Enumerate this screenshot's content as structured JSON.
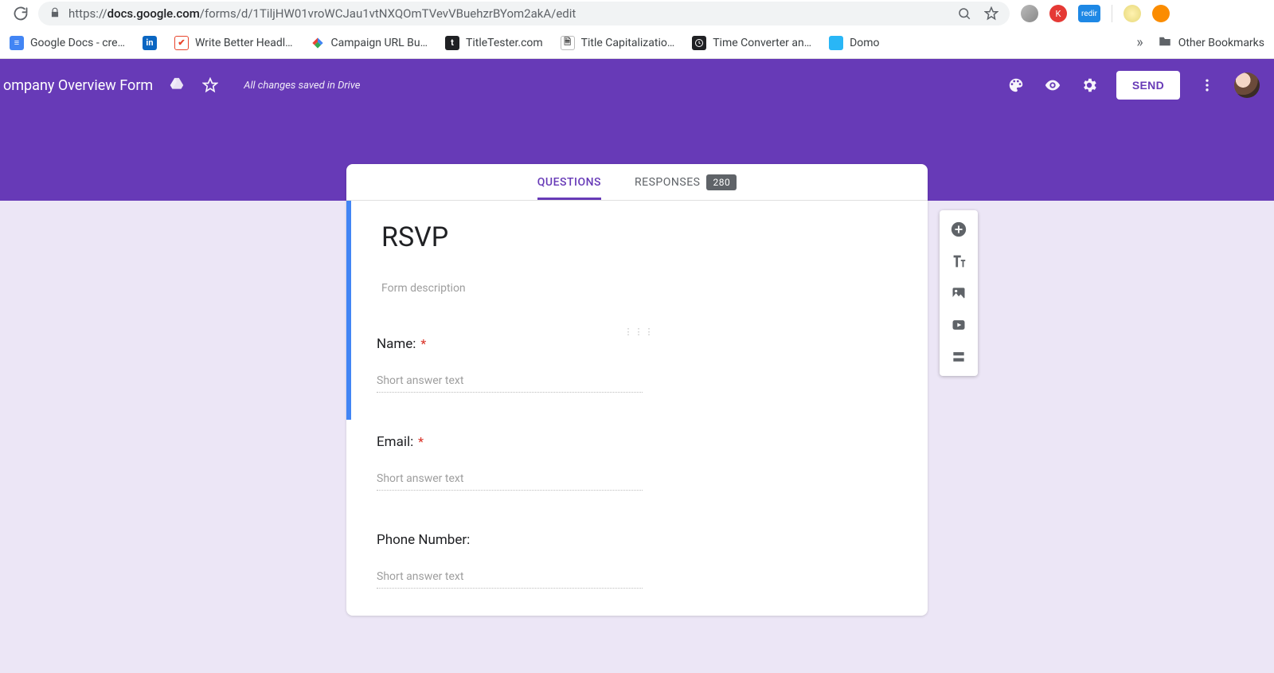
{
  "browser": {
    "url_prefix": "https://",
    "url_host": "docs.google.com",
    "url_path": "/forms/d/1TiljHW01vroWCJau1vtNXQOmTVevVBuehzrBYom2akA/edit"
  },
  "bookmarks": [
    {
      "label": "Google Docs - cre…",
      "color": "#4285f4",
      "text": "≡"
    },
    {
      "label": "",
      "color": "#0a66c2",
      "text": "in"
    },
    {
      "label": "Write Better Headl…",
      "color": "#e8452c",
      "text": "✔"
    },
    {
      "label": "Campaign URL Bu…",
      "color": "#ffffff",
      "text": "◆"
    },
    {
      "label": "TitleTester.com",
      "color": "#202124",
      "text": "t"
    },
    {
      "label": "Title Capitalizatio…",
      "color": "#ffffff",
      "text": "🗎"
    },
    {
      "label": "Time Converter an…",
      "color": "#202124",
      "text": "◷"
    },
    {
      "label": "Domo",
      "color": "#29b6f6",
      "text": ""
    }
  ],
  "bookmarks_overflow": {
    "chevrons": "»",
    "other": "Other Bookmarks"
  },
  "header": {
    "doc_title": "ompany Overview Form",
    "save_status": "All changes saved in Drive",
    "send_label": "SEND"
  },
  "tabs": {
    "questions": "QUESTIONS",
    "responses": "RESPONSES",
    "response_count": "280"
  },
  "form": {
    "title": "RSVP",
    "description_placeholder": "Form description",
    "questions": [
      {
        "title": "Name:",
        "required": true,
        "placeholder": "Short answer text",
        "active": true
      },
      {
        "title": "Email:",
        "required": true,
        "placeholder": "Short answer text",
        "active": false
      },
      {
        "title": "Phone Number:",
        "required": false,
        "placeholder": "Short answer text",
        "active": false
      }
    ]
  },
  "extensions": {
    "redir_label": "redir"
  }
}
